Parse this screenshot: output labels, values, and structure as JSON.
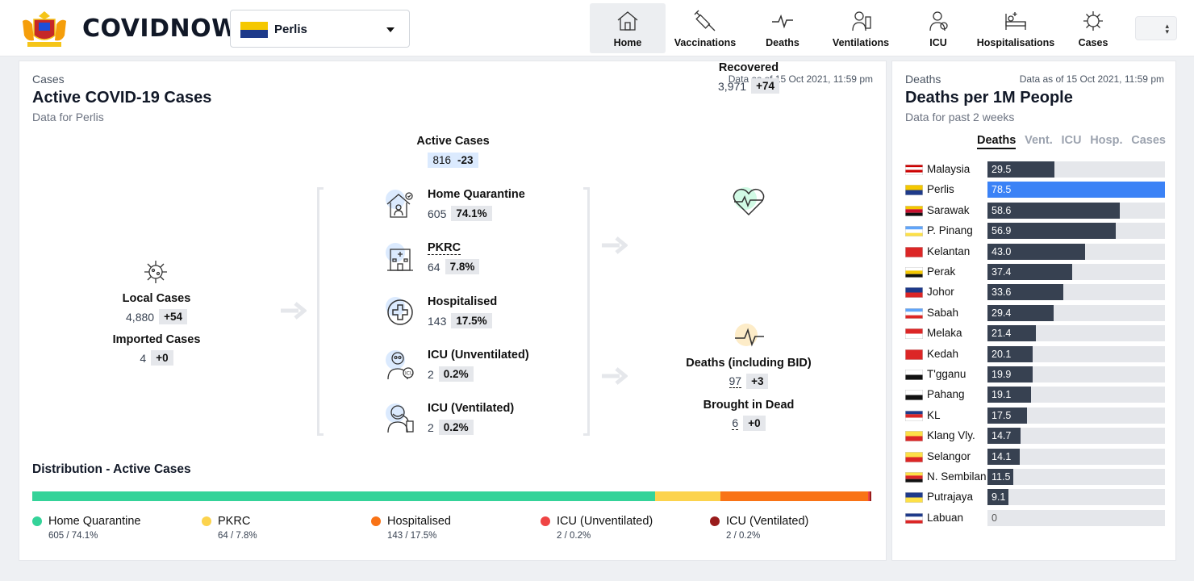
{
  "header": {
    "brand": "COVIDNOW",
    "state_selector": {
      "value": "Perlis"
    },
    "nav": [
      {
        "label": "Home",
        "icon": "home-icon",
        "active": true
      },
      {
        "label": "Vaccinations",
        "icon": "syringe-icon",
        "active": false
      },
      {
        "label": "Deaths",
        "icon": "heartbeat-icon",
        "active": false
      },
      {
        "label": "Ventilations",
        "icon": "ventilator-icon",
        "active": false
      },
      {
        "label": "ICU",
        "icon": "doctor-icon",
        "active": false
      },
      {
        "label": "Hospitalisations",
        "icon": "hospital-bed-icon",
        "active": false
      },
      {
        "label": "Cases",
        "icon": "virus-icon",
        "active": false
      }
    ]
  },
  "cases_card": {
    "kicker": "Cases",
    "title": "Active COVID-19 Cases",
    "subtitle": "Data for Perlis",
    "as_of": "Data as of 15 Oct 2021, 11:59 pm",
    "local": {
      "label": "Local Cases",
      "value": "4,880",
      "delta": "+54"
    },
    "imported": {
      "label": "Imported Cases",
      "value": "4",
      "delta": "+0"
    },
    "active": {
      "label": "Active Cases",
      "value": "816",
      "delta": "-23"
    },
    "breakdown": [
      {
        "label": "Home Quarantine",
        "value": "605",
        "pct": "74.1%",
        "icon": "home-quarantine-icon"
      },
      {
        "label": "PKRC",
        "value": "64",
        "pct": "7.8%",
        "icon": "pkrc-building-icon"
      },
      {
        "label": "Hospitalised",
        "value": "143",
        "pct": "17.5%",
        "icon": "hospital-cross-icon"
      },
      {
        "label": "ICU (Unventilated)",
        "value": "2",
        "pct": "0.2%",
        "icon": "icu-doctor-icon"
      },
      {
        "label": "ICU (Ventilated)",
        "value": "2",
        "pct": "0.2%",
        "icon": "icu-ventilated-icon"
      }
    ],
    "recovered": {
      "label": "Recovered",
      "value": "3,971",
      "delta": "+74"
    },
    "deaths": {
      "label": "Deaths (including BID)",
      "value": "97",
      "delta": "+3"
    },
    "bid": {
      "label": "Brought in Dead",
      "value": "6",
      "delta": "+0"
    }
  },
  "distribution": {
    "title": "Distribution - Active Cases",
    "items": [
      {
        "label": "Home Quarantine",
        "value": "605 / 74.1%",
        "share": 74.1,
        "color": "#34d399"
      },
      {
        "label": "PKRC",
        "value": "64 / 7.8%",
        "share": 7.8,
        "color": "#fcd34d"
      },
      {
        "label": "Hospitalised",
        "value": "143 / 17.5%",
        "share": 17.5,
        "color": "#f97316"
      },
      {
        "label": "ICU (Unventilated)",
        "value": "2 / 0.2%",
        "share": 0.2,
        "color": "#ef4444"
      },
      {
        "label": "ICU (Ventilated)",
        "value": "2 / 0.2%",
        "share": 0.2,
        "color": "#991b1b"
      }
    ]
  },
  "deaths_card": {
    "kicker": "Deaths",
    "title": "Deaths per 1M People",
    "subtitle": "Data for past 2 weeks",
    "as_of": "Data as of 15 Oct 2021, 11:59 pm",
    "tabs": [
      "Deaths",
      "Vent.",
      "ICU",
      "Hosp.",
      "Cases"
    ],
    "active_tab": "Deaths",
    "highlight": "Perlis",
    "max": 78.5,
    "rows": [
      {
        "state": "Malaysia",
        "value": 29.5,
        "label": "29.5"
      },
      {
        "state": "Perlis",
        "value": 78.5,
        "label": "78.5"
      },
      {
        "state": "Sarawak",
        "value": 58.6,
        "label": "58.6"
      },
      {
        "state": "P. Pinang",
        "value": 56.9,
        "label": "56.9"
      },
      {
        "state": "Kelantan",
        "value": 43.0,
        "label": "43.0"
      },
      {
        "state": "Perak",
        "value": 37.4,
        "label": "37.4"
      },
      {
        "state": "Johor",
        "value": 33.6,
        "label": "33.6"
      },
      {
        "state": "Sabah",
        "value": 29.4,
        "label": "29.4"
      },
      {
        "state": "Melaka",
        "value": 21.4,
        "label": "21.4"
      },
      {
        "state": "Kedah",
        "value": 20.1,
        "label": "20.1"
      },
      {
        "state": "T'gganu",
        "value": 19.9,
        "label": "19.9"
      },
      {
        "state": "Pahang",
        "value": 19.1,
        "label": "19.1"
      },
      {
        "state": "KL",
        "value": 17.5,
        "label": "17.5"
      },
      {
        "state": "Klang Vly.",
        "value": 14.7,
        "label": "14.7"
      },
      {
        "state": "Selangor",
        "value": 14.1,
        "label": "14.1"
      },
      {
        "state": "N. Sembilan",
        "value": 11.5,
        "label": "11.5"
      },
      {
        "state": "Putrajaya",
        "value": 9.1,
        "label": "9.1"
      },
      {
        "state": "Labuan",
        "value": 0,
        "label": "0"
      }
    ]
  }
}
